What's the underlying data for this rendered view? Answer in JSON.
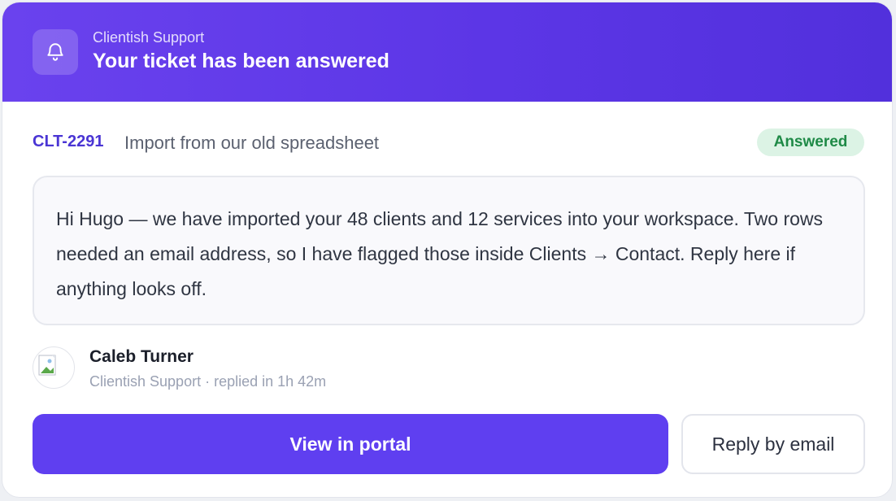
{
  "header": {
    "bell_icon": "bell-icon",
    "subtitle": "Clientish Support",
    "title": "Your ticket has been answered"
  },
  "ticket": {
    "id": "CLT-2291",
    "subject": "Import from our old spreadsheet",
    "status": "Answered"
  },
  "message": {
    "body": "Hi Hugo — we have imported your 48 clients and 12 services into your workspace. Two rows needed an email address, so I have flagged those inside Clients → Contact. Reply here if anything looks off."
  },
  "author": {
    "avatar_icon": "broken-image-icon",
    "name": "Caleb Turner",
    "meta": "Clientish Support · replied in 1h 42m"
  },
  "actions": {
    "primary_label": "View in portal",
    "secondary_label": "Reply by email"
  },
  "colors": {
    "header_gradient_start": "#6a42ee",
    "header_gradient_end": "#5230dc",
    "primary_button": "#5f3ff0",
    "ticket_id": "#4a35d4",
    "status_bg": "#dcf3e5",
    "status_text": "#1f8a47"
  }
}
